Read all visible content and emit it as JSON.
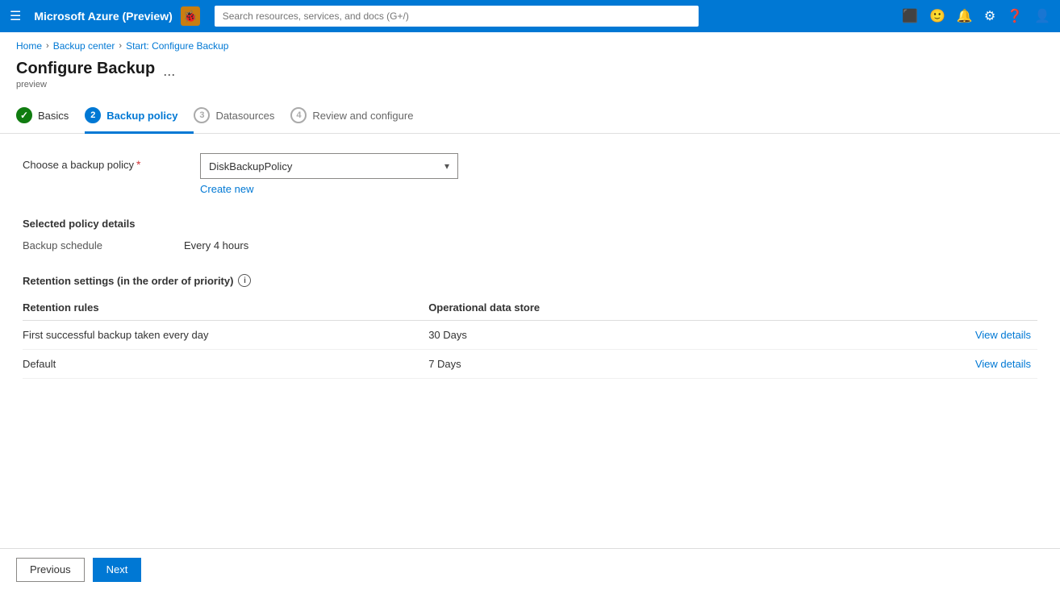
{
  "topNav": {
    "appTitle": "Microsoft Azure (Preview)",
    "searchPlaceholder": "Search resources, services, and docs (G+/)",
    "bugIconSymbol": "🐞"
  },
  "breadcrumb": {
    "items": [
      "Home",
      "Backup center",
      "Start: Configure Backup"
    ]
  },
  "pageHeader": {
    "title": "Configure Backup",
    "preview": "preview",
    "moreOptions": "..."
  },
  "steps": [
    {
      "number": "✓",
      "label": "Basics",
      "state": "completed"
    },
    {
      "number": "2",
      "label": "Backup policy",
      "state": "active"
    },
    {
      "number": "3",
      "label": "Datasources",
      "state": "inactive"
    },
    {
      "number": "4",
      "label": "Review and configure",
      "state": "inactive"
    }
  ],
  "form": {
    "policyLabel": "Choose a backup policy",
    "requiredMark": "*",
    "selectedPolicy": "DiskBackupPolicy",
    "createNewLabel": "Create new"
  },
  "policyDetails": {
    "sectionTitle": "Selected policy details",
    "scheduleLabel": "Backup schedule",
    "scheduleValue": "Every 4 hours"
  },
  "retention": {
    "sectionTitle": "Retention settings (in the order of priority)",
    "infoIcon": "i",
    "tableHeaders": {
      "rules": "Retention rules",
      "store": "Operational data store",
      "action": ""
    },
    "rows": [
      {
        "rule": "First successful backup taken every day",
        "store": "30 Days",
        "actionLabel": "View details"
      },
      {
        "rule": "Default",
        "store": "7 Days",
        "actionLabel": "View details"
      }
    ]
  },
  "footer": {
    "previousLabel": "Previous",
    "nextLabel": "Next"
  }
}
